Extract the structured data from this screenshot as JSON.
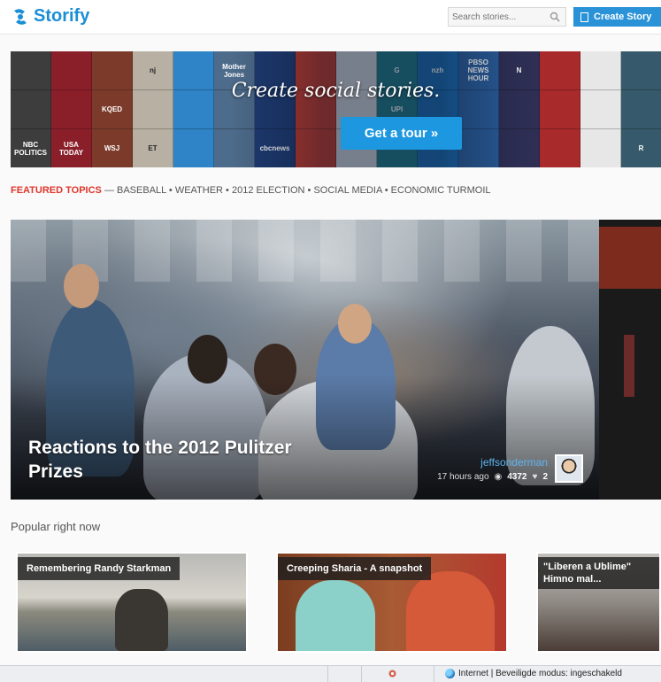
{
  "header": {
    "logo_text": "Storify",
    "search_placeholder": "Search stories...",
    "create_label": "Create Story"
  },
  "banner": {
    "title": "Create social stories.",
    "cta_label": "Get a tour »",
    "tiles": [
      "",
      "",
      "",
      "nj",
      "",
      "Mother Jones",
      "",
      "",
      "",
      "G",
      "nzh",
      "PBSO NEWS HOUR",
      "N",
      "",
      "",
      "",
      "",
      "",
      "KQED",
      "",
      "",
      "",
      "",
      "",
      "",
      "UPI",
      "",
      "",
      "",
      "",
      "",
      "",
      "NBC POLITICS",
      "USA TODAY",
      "WSJ",
      "ET",
      "",
      "",
      "cbcnews",
      "",
      "",
      "",
      "",
      "",
      "",
      "",
      "",
      "R"
    ]
  },
  "topics": {
    "label": "FEATURED TOPICS",
    "list": "— BASEBALL • WEATHER • 2012 ELECTION • SOCIAL MEDIA • ECONOMIC TURMOIL"
  },
  "hero": {
    "title": "Reactions to the 2012 Pulitzer Prizes",
    "author": "jeffsonderman",
    "time": "17 hours ago",
    "views": "4372",
    "likes": "2"
  },
  "popular": {
    "heading": "Popular right now",
    "cards": [
      {
        "title": "Remembering Randy Starkman"
      },
      {
        "title": "Creeping Sharia - A snapshot"
      },
      {
        "title": "\"Liberen a Ublime\" Himno mal..."
      }
    ]
  },
  "statusbar": {
    "zone_text": "Internet | Beveiligde modus: ingeschakeld"
  },
  "colors": {
    "brand": "#1a8fd6",
    "accent_red": "#e0352b",
    "cta": "#1d97e0"
  }
}
